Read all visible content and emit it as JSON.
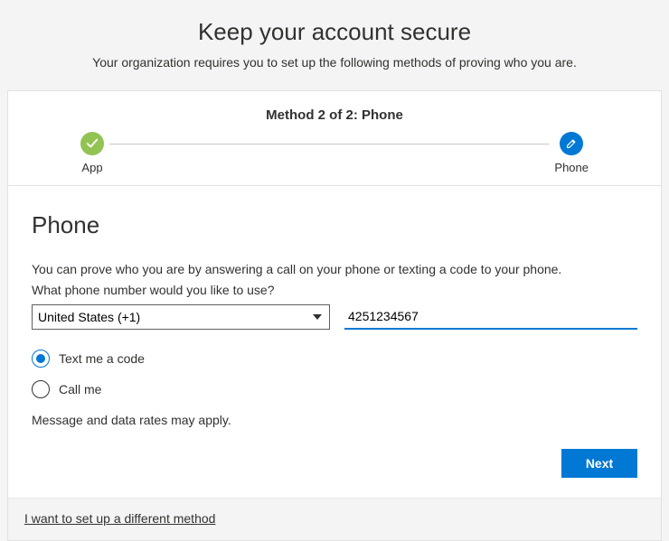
{
  "header": {
    "title": "Keep your account secure",
    "subtitle": "Your organization requires you to set up the following methods of proving who you are."
  },
  "stepper": {
    "method_label": "Method 2 of 2: Phone",
    "steps": [
      {
        "label": "App"
      },
      {
        "label": "Phone"
      }
    ]
  },
  "phone": {
    "section_title": "Phone",
    "intro": "You can prove who you are by answering a call on your phone or texting a code to your phone.",
    "prompt": "What phone number would you like to use?",
    "country_value": "United States (+1)",
    "number_value": "4251234567",
    "options": {
      "text": "Text me a code",
      "call": "Call me",
      "selected": "text"
    },
    "rates": "Message and data rates may apply."
  },
  "buttons": {
    "next": "Next"
  },
  "footer": {
    "alt_method": "I want to set up a different method"
  }
}
